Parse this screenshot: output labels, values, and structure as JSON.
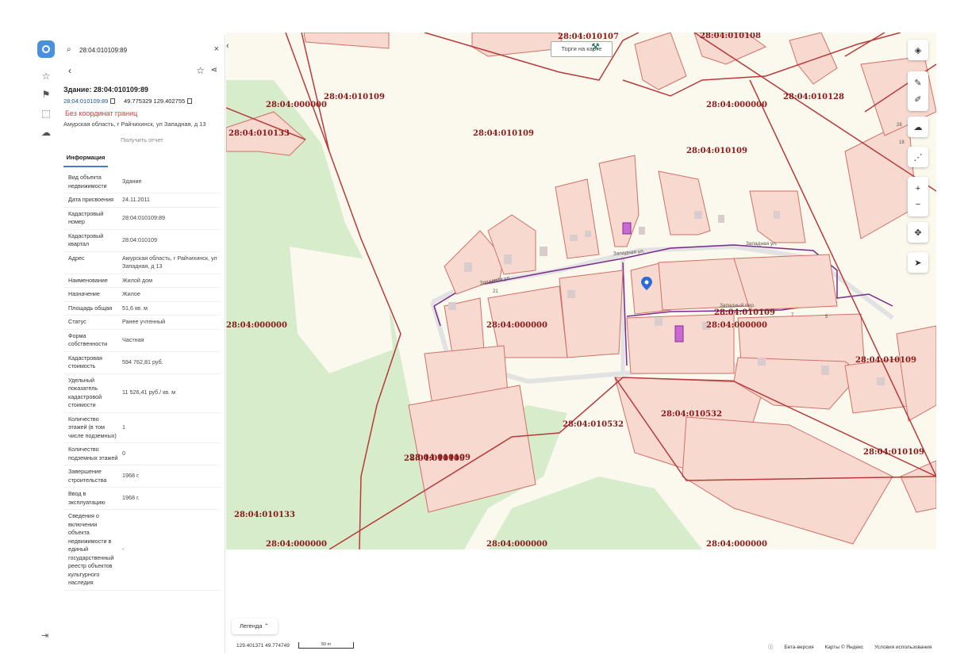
{
  "search": {
    "value": "28:04:010109:89",
    "icon": "search-icon",
    "close_icon": "close-icon"
  },
  "object": {
    "title": "Здание: 28:04:010109:89",
    "cadastral_link": "28:04:010109:89",
    "coordinates": "49.775329 129.402755",
    "warning": "Без координат границ",
    "address": "Амурская область, г Райчихинск, ул Западная, д 13",
    "report_button": "Получить отчет",
    "tab": "Информация"
  },
  "properties": [
    {
      "key": "Вид объекта недвижимости",
      "value": "Здание"
    },
    {
      "key": "Дата присвоения",
      "value": "24.11.2011"
    },
    {
      "key": "Кадастровый номер",
      "value": "28:04:010109:89"
    },
    {
      "key": "Кадастровый квартал",
      "value": "28:04:010109"
    },
    {
      "key": "Адрес",
      "value": "Амурская область, г Райчихинск, ул Западная, д 13"
    },
    {
      "key": "Наименование",
      "value": "Жилой дом"
    },
    {
      "key": "Назначение",
      "value": "Жилое"
    },
    {
      "key": "Площадь общая",
      "value": "51,6  кв. м"
    },
    {
      "key": "Статус",
      "value": "Ранее учтенный"
    },
    {
      "key": "Форма собственности",
      "value": "Частная"
    },
    {
      "key": "Кадастровая стоимость",
      "value": "594 762,81 руб."
    },
    {
      "key": "Удельный показатель кадастровой стоимости",
      "value": "11 526,41 руб./ кв. м"
    },
    {
      "key": "Количество этажей (в том числе подземных)",
      "value": "1"
    },
    {
      "key": "Количество подземных этажей",
      "value": "0"
    },
    {
      "key": "Завершение строительства",
      "value": "1968 г."
    },
    {
      "key": "Ввод в эксплуатацию",
      "value": "1968 г."
    },
    {
      "key": "Сведения о включении объекта недвижимости в единый государственный реестр объектов культурного наследия",
      "value": "-"
    }
  ],
  "map": {
    "auction_label": "Торги на карте",
    "street_labels": [
      "Западная ул.",
      "Западная ул.",
      "Западный пер.",
      "Западная ул."
    ],
    "cadastral_labels": [
      "28:04:010107",
      "28:04:010108",
      "28:04:010109",
      "28:04:000000",
      "28:04:000000",
      "28:04:010128",
      "28:04:010133",
      "28:04:010109",
      "28:04:010109",
      "28:04:000000",
      "28:04:010109",
      "28:04:000000",
      "28:04:010109",
      "28:04:000000",
      "28:04:010109",
      "28:04:010532",
      "28:04:010532",
      "28:04:010109",
      "28:04:010109",
      "28:04:010133",
      "28:04:000000",
      "28:04:000000",
      "28:04:000000"
    ],
    "house_numbers": [
      "21",
      "28",
      "18",
      "7",
      "5"
    ],
    "colors": {
      "boundary": "#b83a3a",
      "parcel_fill": "#f7d9cf",
      "parcel_stroke": "#d07066",
      "street_line": "#7a2a8a",
      "forest": "#d6eccb",
      "water": "#b8cfe0"
    }
  },
  "toolbar_icons": [
    "layers-icon",
    "ruler-icon",
    "edit-icon",
    "upload-icon",
    "share-nodes-icon",
    "zoom-in-icon",
    "zoom-out-icon",
    "move-icon",
    "locate-icon"
  ],
  "bottom": {
    "legend": "Легенда",
    "coords": "129.401371   49.774749",
    "scale": "50 m",
    "beta": "Бета-версия",
    "maps_credit": "Карты © Яндекс",
    "terms": "Условия использования"
  }
}
